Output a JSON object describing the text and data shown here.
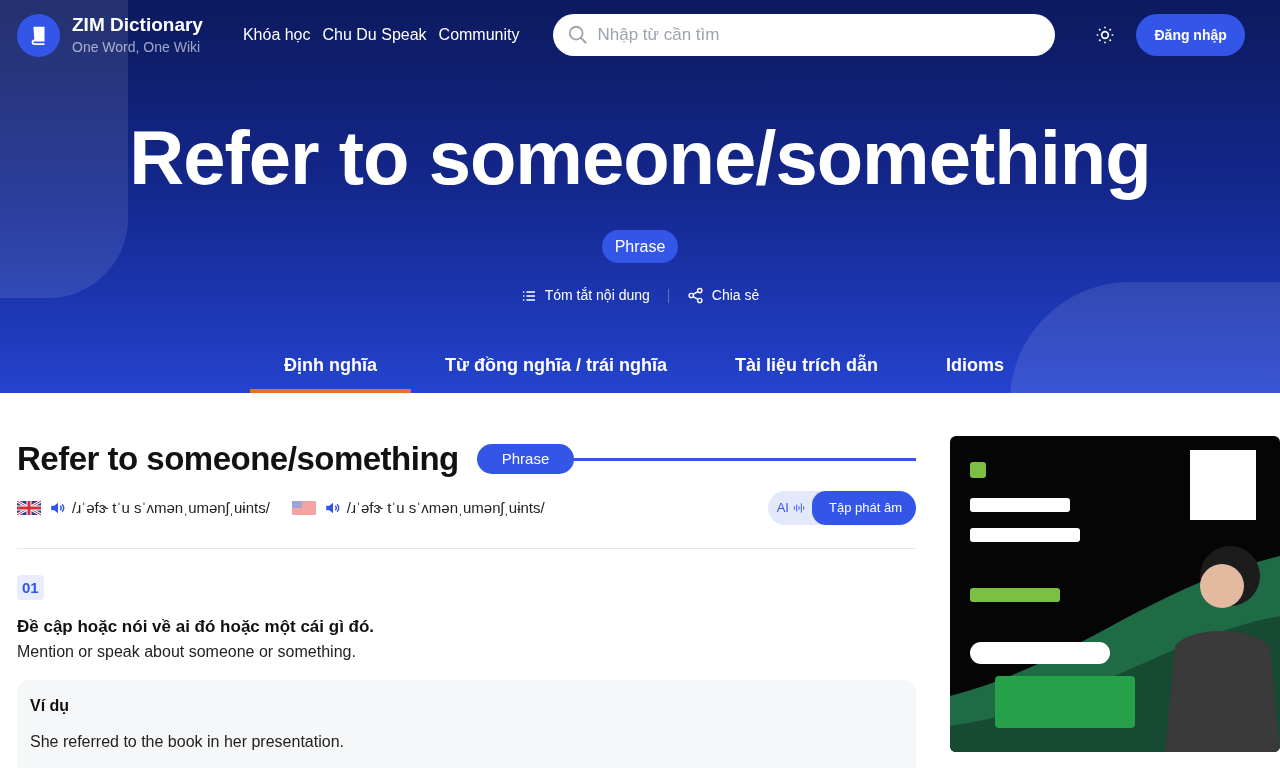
{
  "header": {
    "brand": "ZIM Dictionary",
    "tagline": "One Word, One Wiki",
    "nav": [
      "Khóa học",
      "Chu Du Speak",
      "Community"
    ],
    "search": {
      "placeholder": "Nhập từ cần tìm"
    },
    "login": "Đăng nhập"
  },
  "hero": {
    "title": "Refer to someone/something",
    "badge": "Phrase",
    "actions": [
      {
        "kind": "summary",
        "label": "Tóm tắt nội dung"
      },
      {
        "kind": "share",
        "label": "Chia sẻ"
      }
    ]
  },
  "tabs": [
    {
      "label": "Định nghĩa",
      "selected": true
    },
    {
      "label": "Từ đồng nghĩa / trái nghĩa",
      "selected": false
    },
    {
      "label": "Tài liệu trích dẫn",
      "selected": false
    },
    {
      "label": "Idioms",
      "selected": false
    }
  ],
  "entry": {
    "title": "Refer to someone/something",
    "badge": "Phrase",
    "pronunciations": [
      {
        "kind": "uk",
        "ipa": "/ɹˈəfɝ tˈu sˈʌmənˌumənʃˌuɨnts/"
      },
      {
        "kind": "us",
        "ipa": "/ɹˈəfɝ tˈu sˈʌmənˌumənʃˌuɨnts/"
      }
    ],
    "practice": {
      "ai": "AI",
      "label": "Tập phát âm"
    },
    "senses": [
      {
        "number": "01",
        "definition_vi": "Đề cập hoặc nói về ai đó hoặc một cái gì đó.",
        "definition_en": "Mention or speak about someone or something.",
        "example_heading": "Ví dụ",
        "example": "She referred to the book in her presentation."
      }
    ]
  }
}
